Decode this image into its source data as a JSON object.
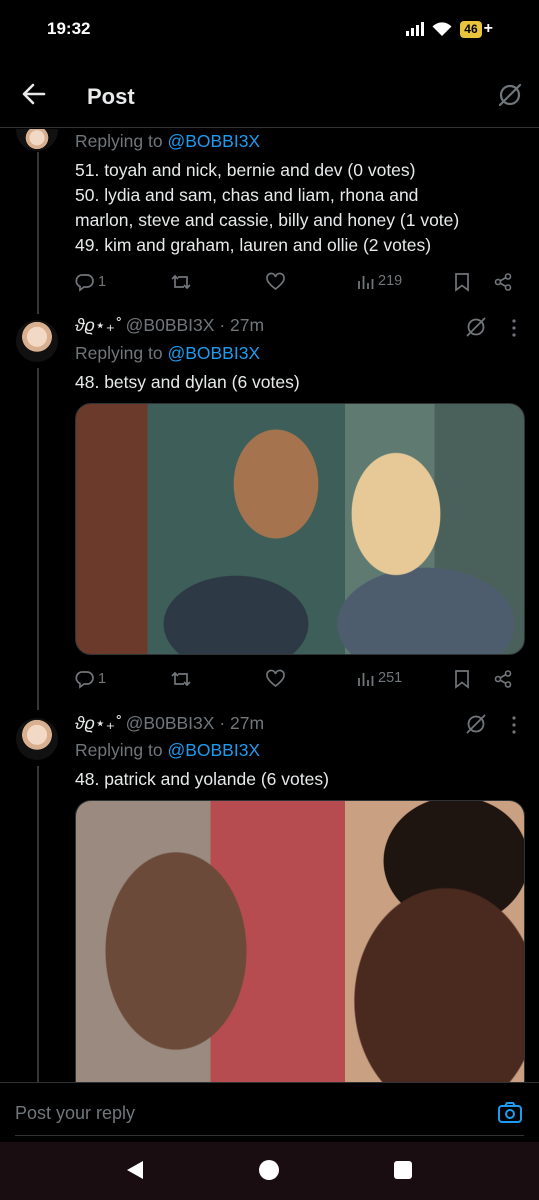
{
  "status": {
    "time": "19:32",
    "battery": "46",
    "battery_suffix": "+"
  },
  "header": {
    "title": "Post"
  },
  "tweets": [
    {
      "replying_prefix": "Replying to",
      "replying_handle": "@BOBBI3X",
      "lines": [
        "51. toyah and nick, bernie and dev (0 votes)",
        "50. lydia and sam, chas and liam, rhona and",
        "marlon, steve and cassie, billy and honey (1 vote)",
        "49. kim and graham, lauren and ollie (2 votes)"
      ],
      "replies": "1",
      "views": "219"
    },
    {
      "display_name": "ϑϱ⋆₊˚",
      "handle": "@B0BBI3X",
      "time": "· 27m",
      "replying_prefix": "Replying to",
      "replying_handle": "@BOBBI3X",
      "lines": [
        "48. betsy and dylan (6 votes)"
      ],
      "replies": "1",
      "views": "251"
    },
    {
      "display_name": "ϑϱ⋆₊˚",
      "handle": "@B0BBI3X",
      "time": "· 27m",
      "replying_prefix": "Replying to",
      "replying_handle": "@BOBBI3X",
      "lines": [
        "48. patrick and yolande (6 votes)"
      ]
    }
  ],
  "reply_bar": {
    "placeholder": "Post your reply"
  },
  "colors": {
    "link": "#1d9bf0",
    "muted": "#71767b",
    "text": "#e7e9ea",
    "battery": "#e9c33b"
  },
  "icons": [
    "back-arrow-icon",
    "grok-icon",
    "reply-icon",
    "repost-icon",
    "like-icon",
    "views-icon",
    "bookmark-icon",
    "share-icon",
    "more-icon",
    "camera-icon"
  ]
}
